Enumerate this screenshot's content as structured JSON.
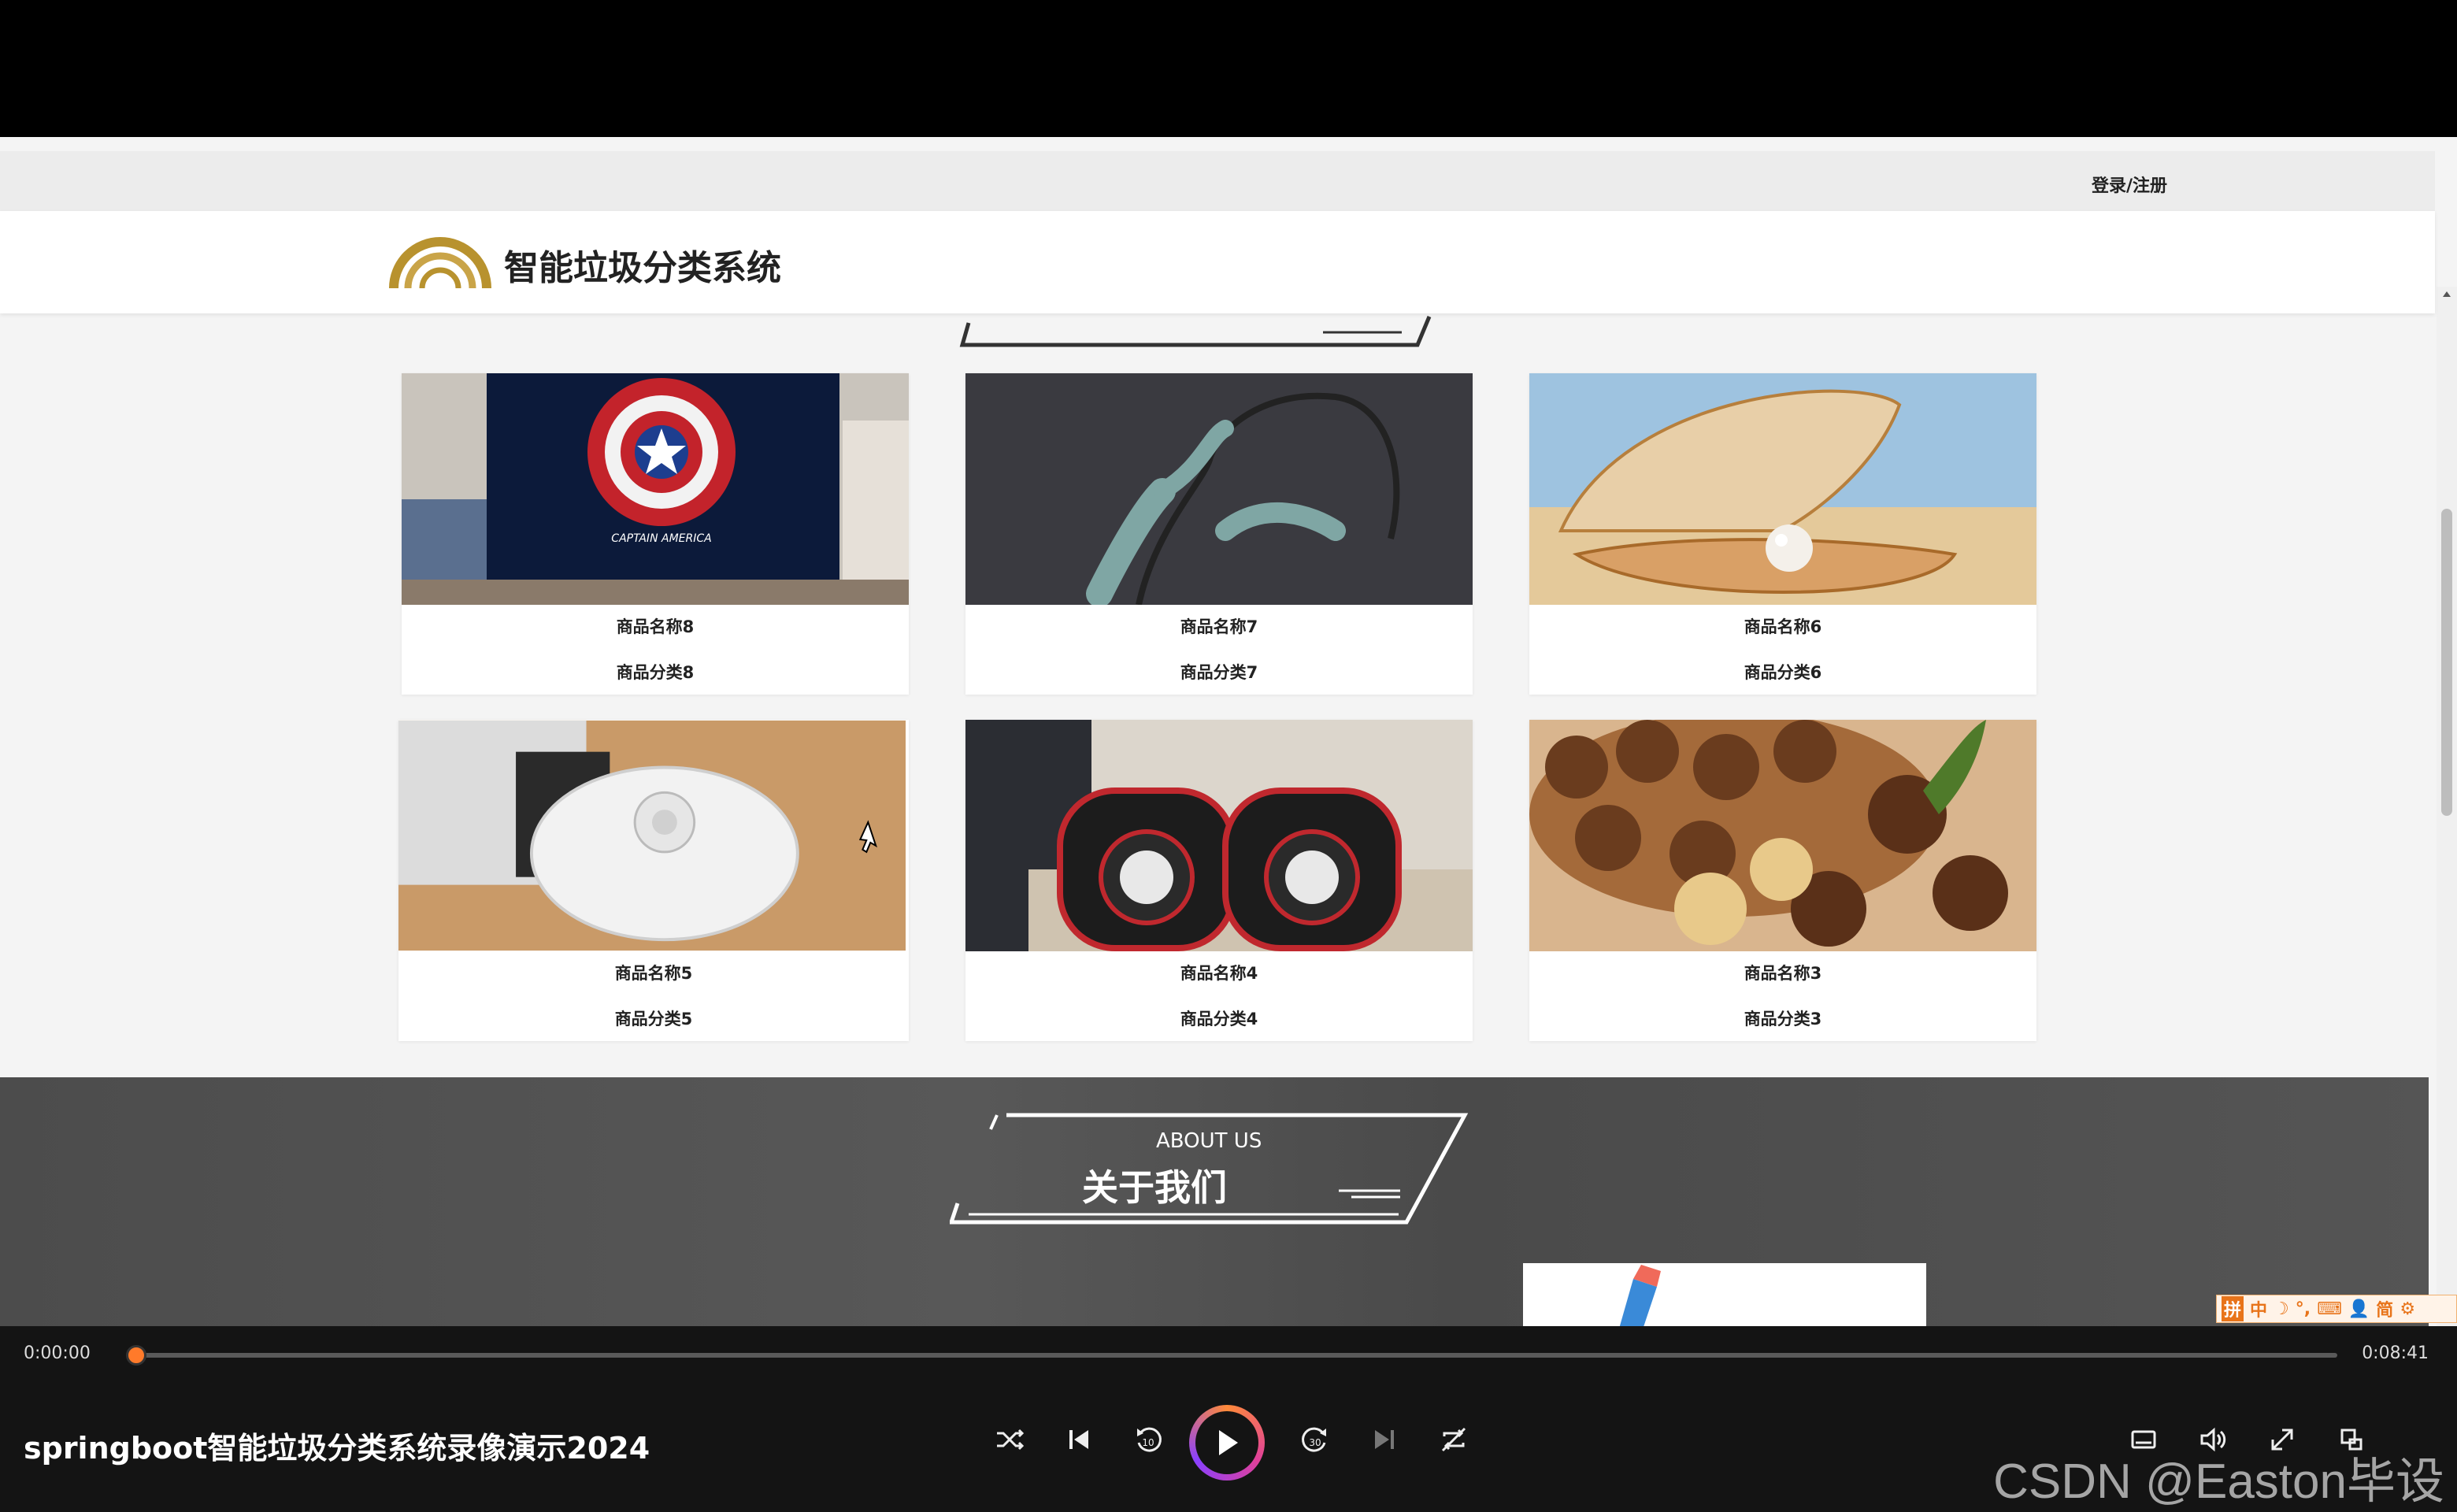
{
  "site": {
    "login_label": "登录/注册",
    "title": "智能垃圾分类系统"
  },
  "products": [
    {
      "name": "商品名称8",
      "category": "商品分类8"
    },
    {
      "name": "商品名称7",
      "category": "商品分类7"
    },
    {
      "name": "商品名称6",
      "category": "商品分类6"
    },
    {
      "name": "商品名称5",
      "category": "商品分类5"
    },
    {
      "name": "商品名称4",
      "category": "商品分类4"
    },
    {
      "name": "商品名称3",
      "category": "商品分类3"
    }
  ],
  "product_images": [
    "captain-america-tv-image",
    "bone-conduction-headphones-image",
    "pearl-shell-image",
    "robot-vacuum-image",
    "speakers-image",
    "macadamia-nuts-image"
  ],
  "tv_caption": "CAPTAIN AMERICA",
  "about": {
    "en": "ABOUT US",
    "cn": "关于我们"
  },
  "player": {
    "current_time": "0:00:00",
    "duration": "0:08:41",
    "video_title": "springboot智能垃圾分类系统录像演示2024",
    "progress": 0
  },
  "ime": [
    "拼",
    "中",
    "☽",
    "°,",
    "⌨",
    "👤",
    "简",
    "⚙"
  ],
  "watermark": "CSDN @Easton毕设",
  "colors": {
    "accent": "#ff7a2a",
    "logo": "#b8922e",
    "about_bg": "#525252"
  }
}
